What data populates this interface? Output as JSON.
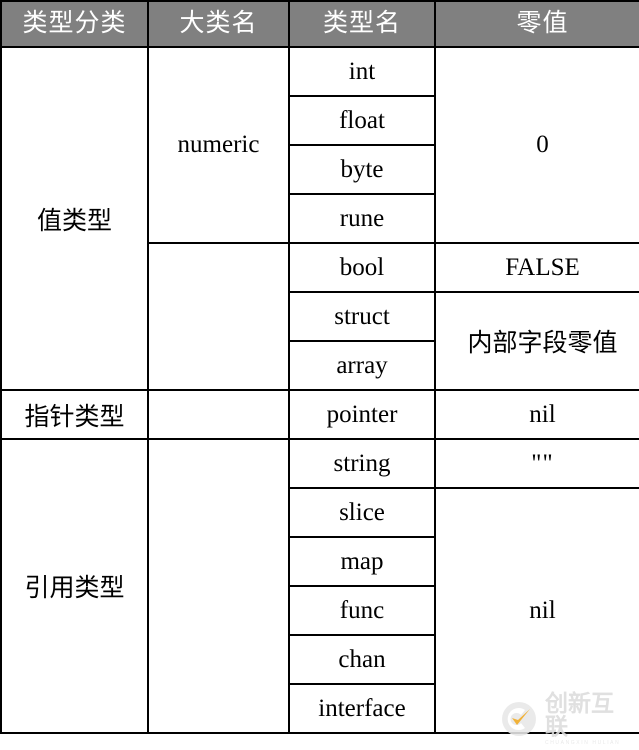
{
  "table": {
    "headers": [
      {
        "label": "类型分类",
        "name": "header-type-category"
      },
      {
        "label": "大类名",
        "name": "header-group-name"
      },
      {
        "label": "类型名",
        "name": "header-type-name"
      },
      {
        "label": "零值",
        "name": "header-zero-value"
      }
    ],
    "rows": [
      {
        "category": "值类型",
        "group": "numeric",
        "type": "int",
        "zero": "0"
      },
      {
        "category": "",
        "group": "",
        "type": "float",
        "zero": ""
      },
      {
        "category": "",
        "group": "",
        "type": "byte",
        "zero": ""
      },
      {
        "category": "",
        "group": "",
        "type": "rune",
        "zero": ""
      },
      {
        "category": "",
        "group": "",
        "type": "bool",
        "zero": "FALSE"
      },
      {
        "category": "",
        "group": "",
        "type": "struct",
        "zero": "内部字段零值"
      },
      {
        "category": "",
        "group": "",
        "type": "array",
        "zero": ""
      },
      {
        "category": "指针类型",
        "group": "",
        "type": "pointer",
        "zero": "nil"
      },
      {
        "category": "引用类型",
        "group": "",
        "type": "string",
        "zero": "\"\""
      },
      {
        "category": "",
        "group": "",
        "type": "slice",
        "zero": "nil"
      },
      {
        "category": "",
        "group": "",
        "type": "map",
        "zero": ""
      },
      {
        "category": "",
        "group": "",
        "type": "func",
        "zero": ""
      },
      {
        "category": "",
        "group": "",
        "type": "chan",
        "zero": ""
      },
      {
        "category": "",
        "group": "",
        "type": "interface",
        "zero": ""
      }
    ],
    "cells": {
      "value_type": "值类型",
      "pointer_type": "指针类型",
      "reference_type": "引用类型",
      "numeric": "numeric",
      "int": "int",
      "float": "float",
      "byte": "byte",
      "rune": "rune",
      "bool": "bool",
      "struct": "struct",
      "array": "array",
      "pointer": "pointer",
      "string": "string",
      "slice": "slice",
      "map": "map",
      "func": "func",
      "chan": "chan",
      "interface": "interface",
      "zero_number": "0",
      "zero_false": "FALSE",
      "zero_struct": "内部字段零值",
      "zero_nil_pointer": "nil",
      "zero_empty_string": "\"\"",
      "zero_nil_ref": "nil"
    }
  },
  "watermark": {
    "brand": "创新互联",
    "tagline": "CHUANGXIN HULIAN",
    "mark_color": "#f0a81e",
    "text_color": "#dcdcdc"
  },
  "colors": {
    "header_background": "#808080",
    "header_text": "#ffffff",
    "border": "#000000",
    "cell_background": "#ffffff",
    "cell_text": "#000000"
  }
}
